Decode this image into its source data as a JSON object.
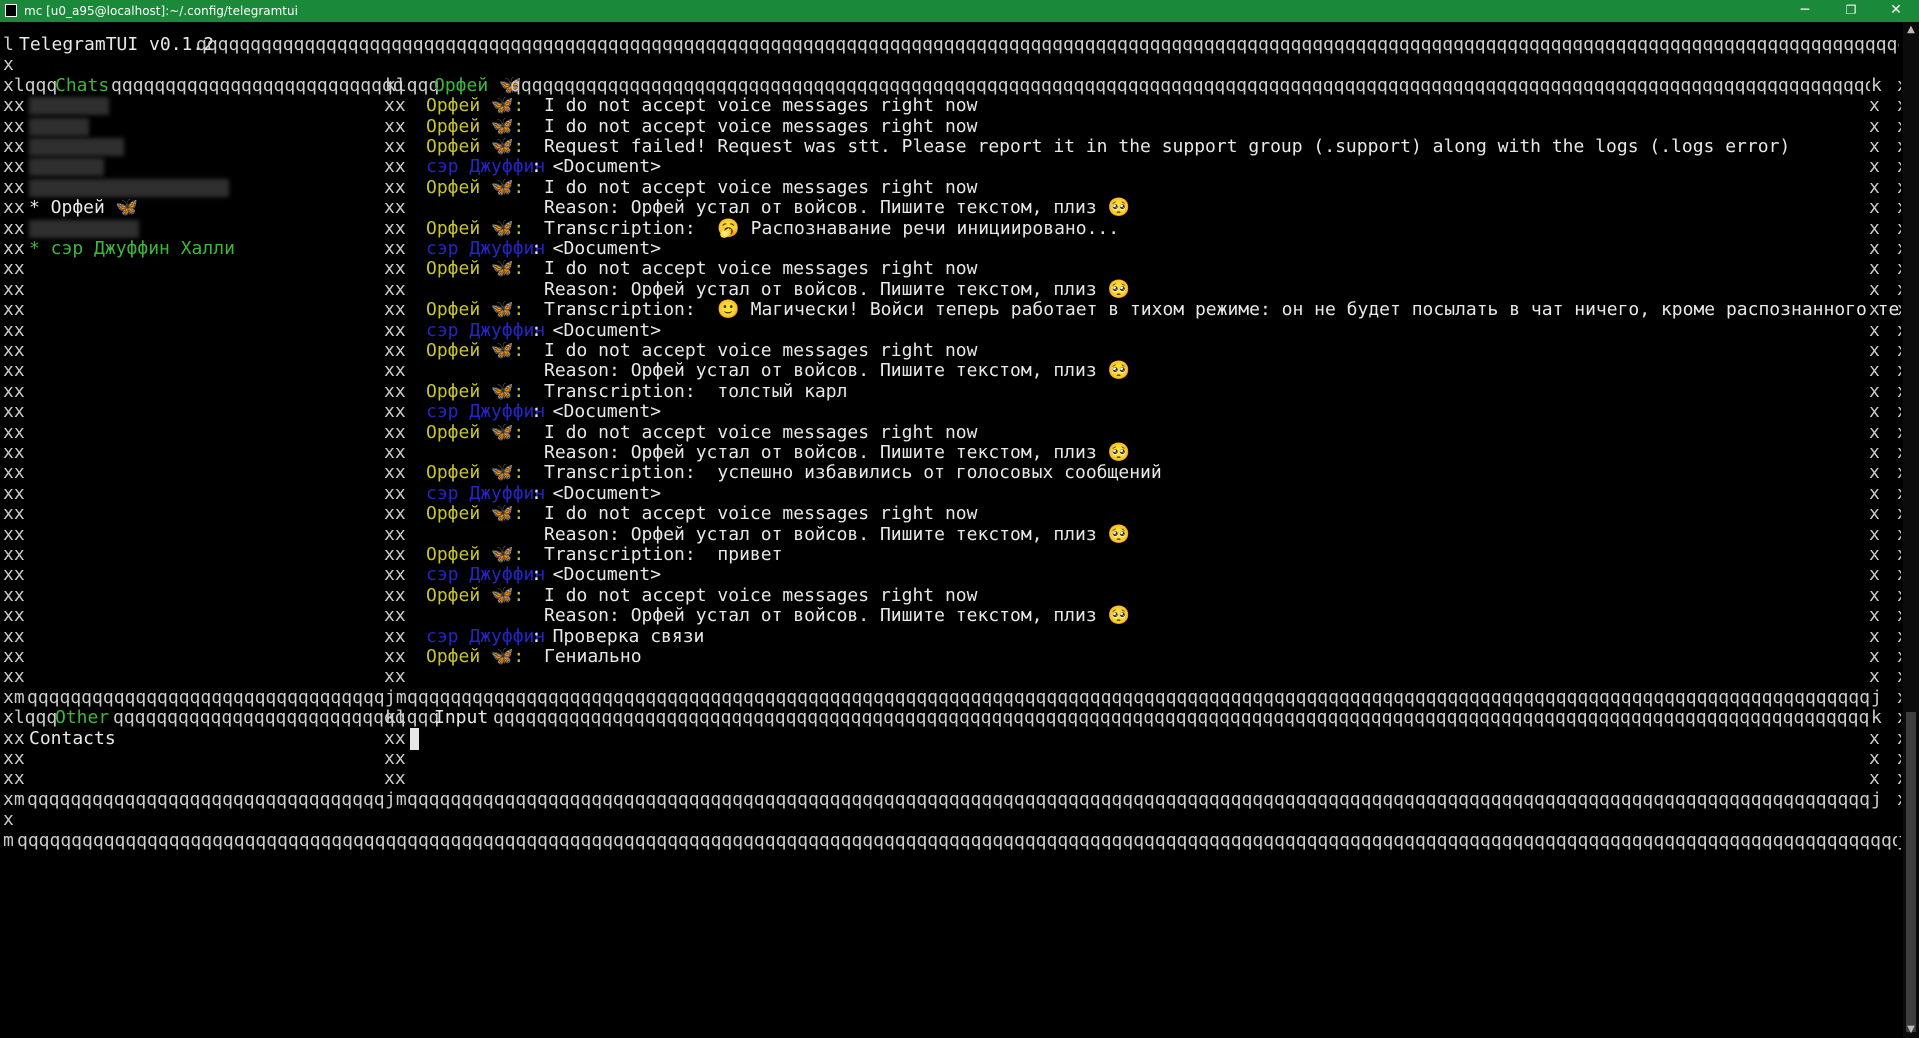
{
  "window": {
    "title": "mc [u0_a95@localhost]:~/.config/telegramtui",
    "minimize_glyph": "─",
    "maximize_glyph": "❐",
    "close_glyph": "✕"
  },
  "colors": {
    "accent_green": "#3bb83b",
    "name_yellow": "#c8c42a",
    "name_blue": "#2424c8",
    "titlebar": "#1a8a3a"
  },
  "border": {
    "top_prefix": "l",
    "app_name": "TelegramTUI v0.1.2",
    "outer_left": "x",
    "inner_left": "xx",
    "inner_right": "x",
    "chats_panel_prefix": "xlqqq",
    "chats_title": "Chats",
    "mid_join": "klqqq",
    "chat_title": "Орфей 🦋",
    "bottom_prefix": "xm",
    "bottom_join": "jm",
    "bottom_end": "j",
    "other_title": "Other",
    "input_title": "Input",
    "final_prefix": "m"
  },
  "sidebar": {
    "chats": [
      {
        "label": "",
        "hidden": true
      },
      {
        "label": "",
        "hidden": true
      },
      {
        "label": "",
        "hidden": true
      },
      {
        "label": "",
        "hidden": true
      },
      {
        "label": "",
        "hidden": true
      },
      {
        "label": "* Орфей 🦋",
        "hidden": false
      },
      {
        "label": "",
        "hidden": true
      },
      {
        "label": "* сэр Джуффин Халли",
        "hidden": false
      }
    ],
    "other": [
      {
        "label": "Contacts"
      }
    ]
  },
  "messages": [
    {
      "sender": "Орфей 🦋:",
      "color": "yellow",
      "text": "I do not accept voice messages right now"
    },
    {
      "sender": "Орфей 🦋:",
      "color": "yellow",
      "text": "I do not accept voice messages right now"
    },
    {
      "sender": "Орфей 🦋:",
      "color": "yellow",
      "text": "Request failed! Request was stt. Please report it in the support group (.support) along with the logs (.logs error)"
    },
    {
      "sender": "сэр Джуффин",
      "color": "blue",
      "text": ": <Document>"
    },
    {
      "sender": "Орфей 🦋:",
      "color": "yellow",
      "text": "I do not accept voice messages right now"
    },
    {
      "sender": "",
      "color": "yellow",
      "text": "Reason: Орфей устал от войсов. Пишите текстом, плиз 🥺"
    },
    {
      "sender": "Орфей 🦋:",
      "color": "yellow",
      "text": "Transcription:  🥱 Распознавание речи инициировано..."
    },
    {
      "sender": "сэр Джуффин",
      "color": "blue",
      "text": ": <Document>"
    },
    {
      "sender": "Орфей 🦋:",
      "color": "yellow",
      "text": "I do not accept voice messages right now"
    },
    {
      "sender": "",
      "color": "yellow",
      "text": "Reason: Орфей устал от войсов. Пишите текстом, плиз 🥺"
    },
    {
      "sender": "Орфей 🦋:",
      "color": "yellow",
      "text": "Transcription:  🙂 Магически! Войси теперь работает в тихом режиме: он не будет посылать в чат ничего, кроме распознанного текста."
    },
    {
      "sender": "сэр Джуффин",
      "color": "blue",
      "text": ": <Document>"
    },
    {
      "sender": "Орфей 🦋:",
      "color": "yellow",
      "text": "I do not accept voice messages right now"
    },
    {
      "sender": "",
      "color": "yellow",
      "text": "Reason: Орфей устал от войсов. Пишите текстом, плиз 🥺"
    },
    {
      "sender": "Орфей 🦋:",
      "color": "yellow",
      "text": "Transcription:  толстый карл"
    },
    {
      "sender": "сэр Джуффин",
      "color": "blue",
      "text": ": <Document>"
    },
    {
      "sender": "Орфей 🦋:",
      "color": "yellow",
      "text": "I do not accept voice messages right now"
    },
    {
      "sender": "",
      "color": "yellow",
      "text": "Reason: Орфей устал от войсов. Пишите текстом, плиз 🥺"
    },
    {
      "sender": "Орфей 🦋:",
      "color": "yellow",
      "text": "Transcription:  успешно избавились от голосовых сообщений"
    },
    {
      "sender": "сэр Джуффин",
      "color": "blue",
      "text": ": <Document>"
    },
    {
      "sender": "Орфей 🦋:",
      "color": "yellow",
      "text": "I do not accept voice messages right now"
    },
    {
      "sender": "",
      "color": "yellow",
      "text": "Reason: Орфей устал от войсов. Пишите текстом, плиз 🥺"
    },
    {
      "sender": "Орфей 🦋:",
      "color": "yellow",
      "text": "Transcription:  привет"
    },
    {
      "sender": "сэр Джуффин",
      "color": "blue",
      "text": ": <Document>"
    },
    {
      "sender": "Орфей 🦋:",
      "color": "yellow",
      "text": "I do not accept voice messages right now"
    },
    {
      "sender": "",
      "color": "yellow",
      "text": "Reason: Орфей устал от войсов. Пишите текстом, плиз 🥺"
    },
    {
      "sender": "сэр Джуффин",
      "color": "blue",
      "text": ": Проверка связи"
    },
    {
      "sender": "Орфей 🦋:",
      "color": "yellow",
      "text": "Гениально"
    },
    {
      "sender": "",
      "color": "yellow",
      "text": ""
    }
  ],
  "input": {
    "value": ""
  }
}
